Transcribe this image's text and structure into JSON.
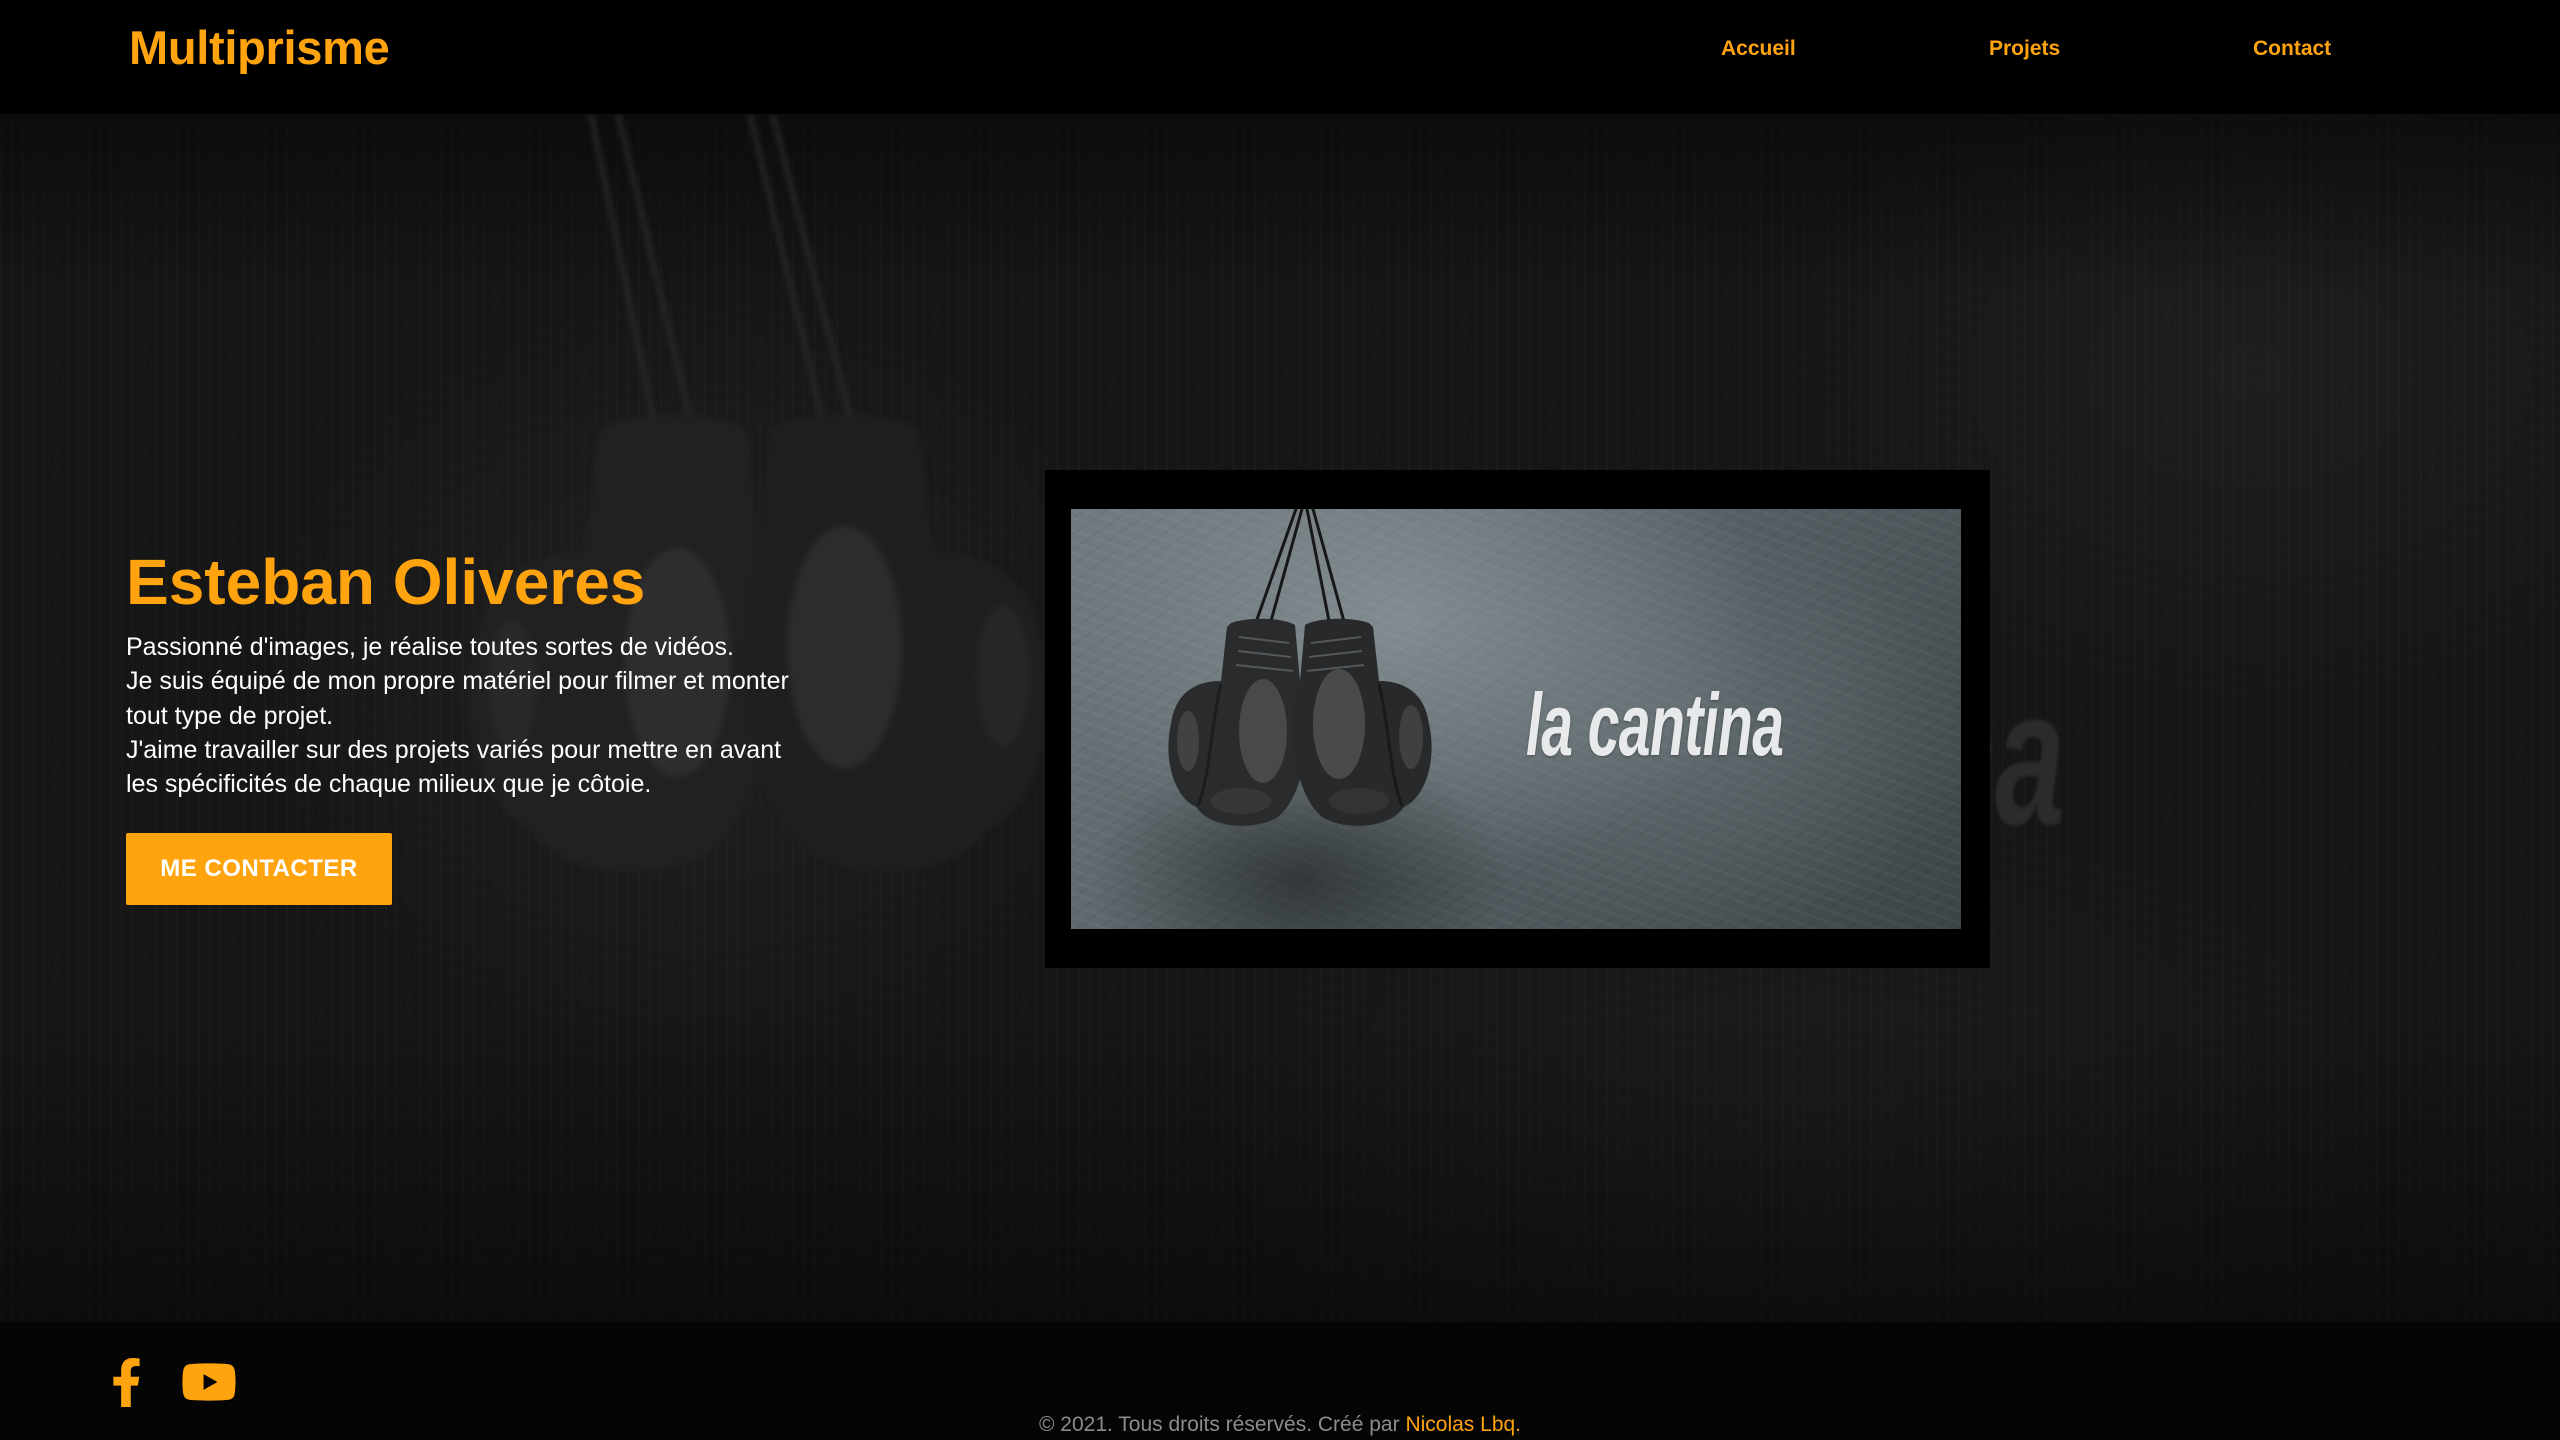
{
  "header": {
    "logo": "Multiprisme",
    "nav": [
      {
        "label": "Accueil"
      },
      {
        "label": "Projets"
      },
      {
        "label": "Contact"
      }
    ]
  },
  "hero": {
    "title": "Esteban Oliveres",
    "description": [
      "Passionné d'images, je réalise toutes sortes de vidéos.",
      "Je suis équipé de mon propre matériel pour filmer et monter",
      "tout type de projet.",
      "J'aime travailler sur des projets variés pour mettre en avant",
      "les spécificités de chaque milieux que je côtoie."
    ],
    "cta_label": "ME CONTACTER"
  },
  "video": {
    "thumbnail_text": "la cantina"
  },
  "footer": {
    "social": [
      {
        "icon": "facebook-icon"
      },
      {
        "icon": "youtube-icon"
      }
    ],
    "copyright": "© 2021. Tous droits réservés. Créé par",
    "author": "Nicolas Lbq."
  },
  "colors": {
    "accent": "#FFA40F",
    "header_bg": "#000000",
    "hero_bg": "#161616",
    "footer_bg": "#050505",
    "text": "#FFFFFF",
    "muted": "#8C8C8C"
  }
}
